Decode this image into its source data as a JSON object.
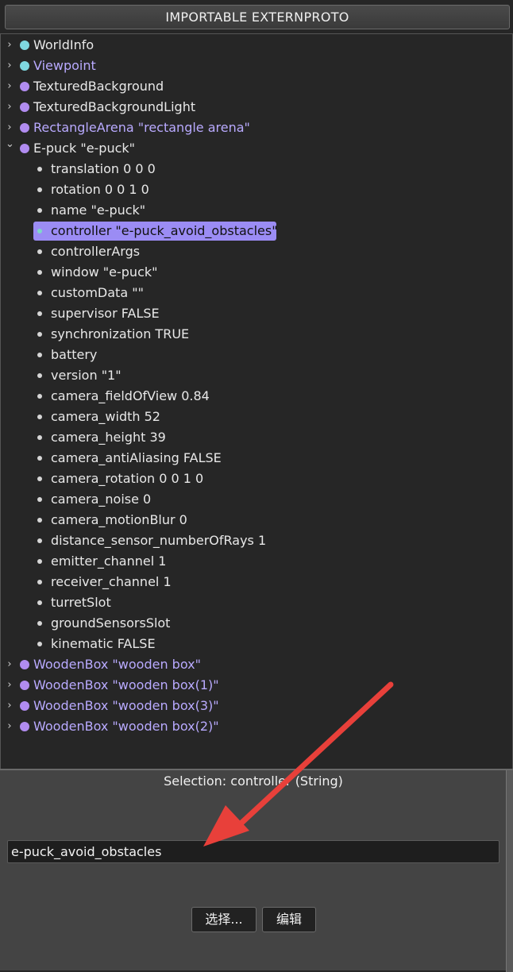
{
  "header": {
    "title": "IMPORTABLE EXTERNPROTO"
  },
  "tree": {
    "nodes_top": [
      {
        "label": "WorldInfo",
        "dot": "cyan",
        "lavender": false
      },
      {
        "label": "Viewpoint",
        "dot": "cyan",
        "lavender": true
      },
      {
        "label": "TexturedBackground",
        "dot": "purple",
        "lavender": false
      },
      {
        "label": "TexturedBackgroundLight",
        "dot": "purple",
        "lavender": false
      },
      {
        "label": "RectangleArena \"rectangle arena\"",
        "dot": "purple",
        "lavender": true
      },
      {
        "label": "E-puck \"e-puck\"",
        "dot": "purple",
        "lavender": false,
        "expanded": true
      }
    ],
    "fields": [
      "translation 0 0 0",
      "rotation 0 0 1 0",
      "name \"e-puck\"",
      "controller \"e-puck_avoid_obstacles\"",
      "controllerArgs",
      "window \"e-puck\"",
      "customData \"\"",
      "supervisor FALSE",
      "synchronization TRUE",
      "battery",
      "version \"1\"",
      "camera_fieldOfView 0.84",
      "camera_width 52",
      "camera_height 39",
      "camera_antiAliasing FALSE",
      "camera_rotation 0 0 1 0",
      "camera_noise 0",
      "camera_motionBlur 0",
      "distance_sensor_numberOfRays 1",
      "emitter_channel 1",
      "receiver_channel 1",
      "turretSlot",
      "groundSensorsSlot",
      "kinematic FALSE"
    ],
    "selected_field_index": 3,
    "nodes_bottom": [
      {
        "label": "WoodenBox \"wooden box\"",
        "dot": "purple",
        "lavender": true
      },
      {
        "label": "WoodenBox \"wooden box(1)\"",
        "dot": "purple",
        "lavender": true
      },
      {
        "label": "WoodenBox \"wooden box(3)\"",
        "dot": "purple",
        "lavender": true
      },
      {
        "label": "WoodenBox \"wooden box(2)\"",
        "dot": "purple",
        "lavender": true
      }
    ]
  },
  "editor": {
    "selection_label": "Selection: controller (String)",
    "value": "e-puck_avoid_obstacles",
    "select_button": "选择...",
    "edit_button": "编辑"
  },
  "colors": {
    "annotation_arrow": "#e8403a",
    "selection_highlight": "#9b8cf4",
    "node_lavender_text": "#b9aaff"
  }
}
